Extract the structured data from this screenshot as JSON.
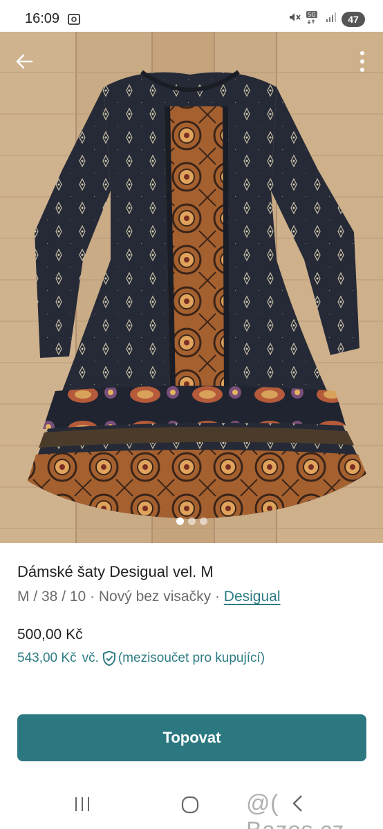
{
  "status_bar": {
    "time": "16:09",
    "battery": "47",
    "network": "5G"
  },
  "icons": {
    "back": "arrow-left-icon",
    "more": "more-vertical-icon",
    "shield": "shield-check-icon",
    "screenshot": "screenshot-icon",
    "mute": "mute-icon",
    "signal": "signal-icon"
  },
  "gallery": {
    "image": "black patterned dress with orange ornamental panel on wooden floor",
    "pages": 3,
    "active_page": 1
  },
  "listing": {
    "title": "Dámské šaty Desigual vel. M",
    "size": "M / 38 / 10",
    "separator": " · ",
    "condition": "Nový bez visačky",
    "brand": "Desigual",
    "price": "500,00 Kč",
    "buyer_price": "543,00 Kč",
    "buyer_price_suffix": "vč.",
    "buyer_price_note": "(mezisoučet pro kupující)"
  },
  "actions": {
    "bump_button": "Topovat"
  },
  "watermark": "@( Bazos.cz",
  "colors": {
    "accent": "#2c7881",
    "link": "#2b7b83",
    "dress": "#252a36",
    "panel": "#a5602f"
  }
}
